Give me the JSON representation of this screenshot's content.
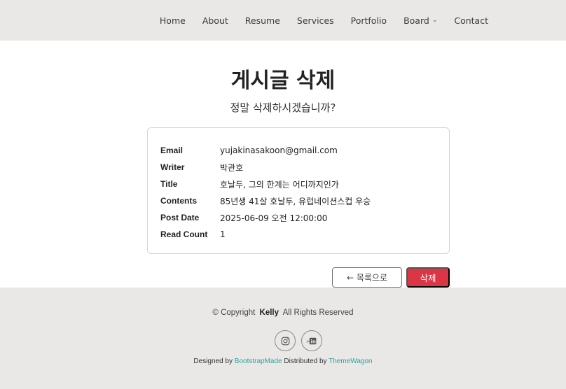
{
  "nav": {
    "items": [
      "Home",
      "About",
      "Resume",
      "Services",
      "Portfolio",
      "Board",
      "Contact"
    ]
  },
  "page": {
    "title": "게시글 삭제",
    "subtitle": "정말 삭제하시겠습니까?"
  },
  "post": {
    "rows": [
      {
        "label": "Email",
        "value": "yujakinasakoon@gmail.com"
      },
      {
        "label": "Writer",
        "value": "박관호"
      },
      {
        "label": "Title",
        "value": "호날두, 그의 한계는 어디까지인가"
      },
      {
        "label": "Contents",
        "value": "85년생 41살 호날두, 유럽네이션스컵 우승"
      },
      {
        "label": "Post Date",
        "value": "2025-06-09 오전 12:00:00"
      },
      {
        "label": "Read Count",
        "value": "1"
      }
    ]
  },
  "buttons": {
    "list": "← 목록으로",
    "delete": "삭제"
  },
  "footer": {
    "copyright_prefix": "© Copyright",
    "copyright_name": "Kelly",
    "copyright_suffix": "All Rights Reserved",
    "social": [
      "instagram-icon",
      "linkedin-icon"
    ],
    "designed_by_label": "Designed by",
    "designed_by": "BootstrapMade",
    "distributed_by_label": "Distributed by",
    "distributed_by": "ThemeWagon"
  }
}
